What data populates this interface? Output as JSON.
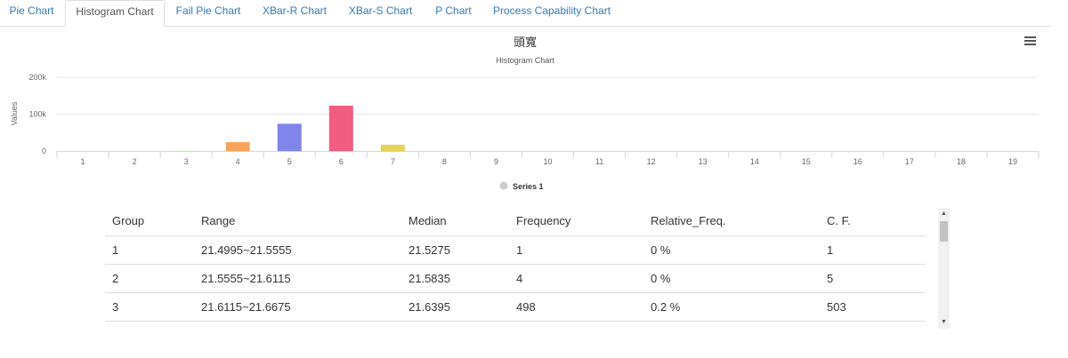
{
  "tabs": [
    {
      "label": "Pie Chart"
    },
    {
      "label": "Histogram Chart"
    },
    {
      "label": "Fail Pie Chart"
    },
    {
      "label": "XBar-R Chart"
    },
    {
      "label": "XBar-S Chart"
    },
    {
      "label": "P Chart"
    },
    {
      "label": "Process Capability Chart"
    }
  ],
  "active_tab": "Histogram Chart",
  "menu_icon": "hamburger-menu-icon",
  "chart_data": {
    "type": "bar",
    "title": "頭寬",
    "subtitle": "Histogram Chart",
    "ylabel": "Values",
    "xlabel": "",
    "ylim": [
      0,
      200000
    ],
    "yticks": [
      "0",
      "100k",
      "200k"
    ],
    "categories": [
      "1",
      "2",
      "3",
      "4",
      "5",
      "6",
      "7",
      "8",
      "9",
      "10",
      "11",
      "12",
      "13",
      "14",
      "15",
      "16",
      "17",
      "18",
      "19"
    ],
    "series": [
      {
        "name": "Series 1",
        "values": [
          1,
          4,
          498,
          24000,
          74000,
          123000,
          17000,
          0,
          0,
          0,
          0,
          0,
          0,
          0,
          0,
          0,
          0,
          0,
          0
        ]
      }
    ],
    "bar_colors": [
      "#7cb5ec",
      "#434348",
      "#90ed7d",
      "#f7a35c",
      "#8085e9",
      "#f15c80",
      "#e4d354",
      "#2b908f",
      "#f45b5b",
      "#91e8e1",
      "#7cb5ec",
      "#434348",
      "#90ed7d",
      "#f7a35c",
      "#8085e9",
      "#f15c80",
      "#e4d354",
      "#2b908f",
      "#f45b5b"
    ],
    "legend": [
      {
        "name": "Series 1",
        "color": "#cccccc"
      }
    ],
    "legend_position": "bottom-center",
    "grid": true
  },
  "table": {
    "headers": [
      "Group",
      "Range",
      "Median",
      "Frequency",
      "Relative_Freq.",
      "C. F."
    ],
    "rows": [
      [
        "1",
        "21.4995~21.5555",
        "21.5275",
        "1",
        "0 %",
        "1"
      ],
      [
        "2",
        "21.5555~21.6115",
        "21.5835",
        "4",
        "0 %",
        "5"
      ],
      [
        "3",
        "21.6115~21.6675",
        "21.6395",
        "498",
        "0.2 %",
        "503"
      ]
    ]
  }
}
